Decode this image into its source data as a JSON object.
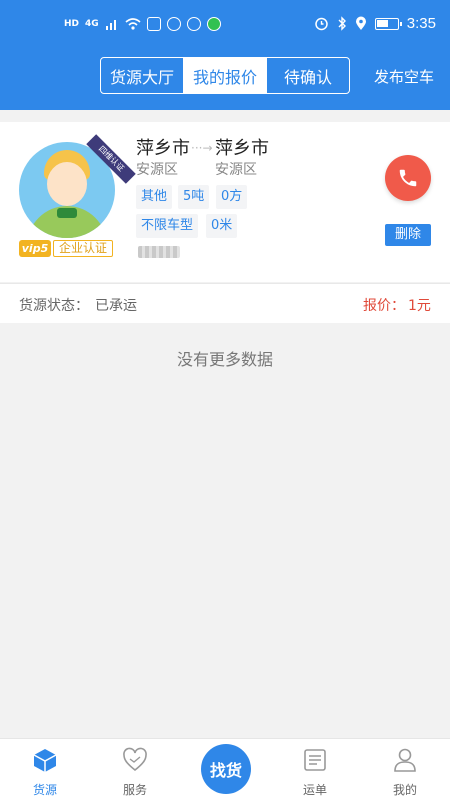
{
  "statusbar": {
    "hd": "HD",
    "net": "4G",
    "time": "3:35",
    "battery_level": 0.6
  },
  "header": {
    "tabs": [
      "货源大厅",
      "我的报价",
      "待确认"
    ],
    "active_tab": "我的报价",
    "publish_label": "发布空车"
  },
  "card": {
    "ribbon": "四维认证",
    "vip": "vip5",
    "enterprise": "企业认证",
    "from_city": "萍乡市",
    "from_district": "安源区",
    "to_city": "萍乡市",
    "to_district": "安源区",
    "tags": [
      "其他",
      "5吨",
      "0方",
      "不限车型",
      "0米"
    ],
    "delete_label": "删除"
  },
  "status": {
    "label": "货源状态：",
    "value": "已承运",
    "price_label": "报价：",
    "price_value": "1元"
  },
  "empty_text": "没有更多数据",
  "tabbar": {
    "items": [
      {
        "label": "货源",
        "icon": "cube-icon"
      },
      {
        "label": "服务",
        "icon": "heart-handshake-icon"
      },
      {
        "label": "找货",
        "icon": "find-goods-button"
      },
      {
        "label": "运单",
        "icon": "document-icon"
      },
      {
        "label": "我的",
        "icon": "user-icon"
      }
    ],
    "active": "货源"
  },
  "colors": {
    "brand": "#2f87e8",
    "call": "#f05a4a",
    "price": "#e04a3a",
    "vip": "#f2b321"
  }
}
